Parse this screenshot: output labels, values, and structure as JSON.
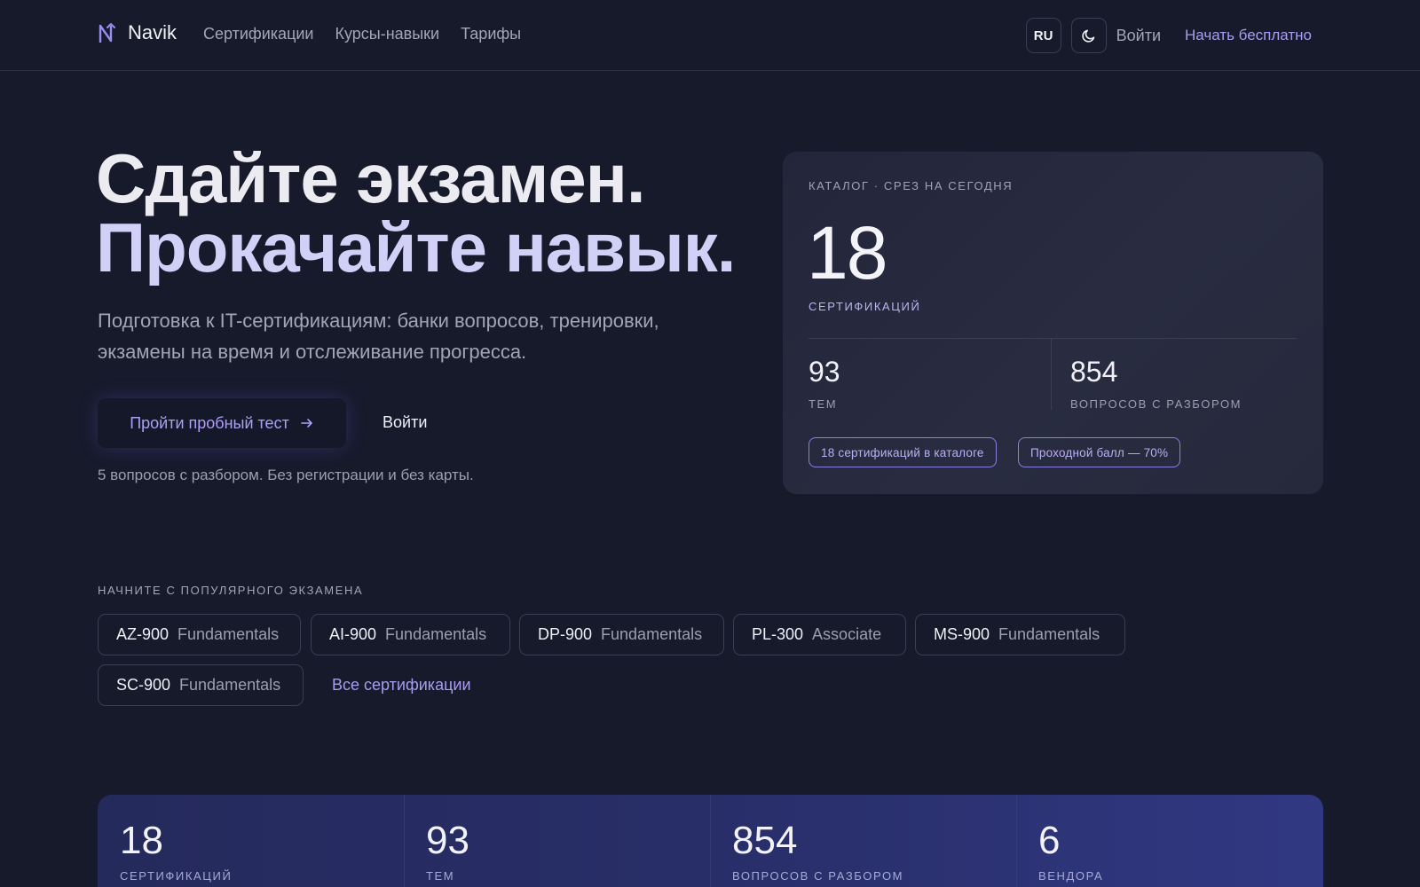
{
  "nav": {
    "logo_text": "Navik",
    "links": [
      "Сертификации",
      "Курсы-навыки",
      "Тарифы"
    ],
    "lang": "RU",
    "login": "Войти",
    "cta": "Начать бесплатно"
  },
  "hero": {
    "title_line1": "Сдайте экзамен.",
    "title_line2": "Прокачайте навык.",
    "subtitle": "Подготовка к IT-сертификациям: банки вопросов, тренировки, экзамены на время и отслеживание прогресса.",
    "primary_button": "Пройти пробный тест",
    "secondary_button": "Войти",
    "note": "5 вопросов с разбором. Без регистрации и без карты."
  },
  "catalog": {
    "eyebrow": "КАТАЛОГ · СРЕЗ НА СЕГОДНЯ",
    "certifications_value": "18",
    "certifications_label": "СЕРТИФИКАЦИЙ",
    "topics_value": "93",
    "topics_label": "ТЕМ",
    "questions_value": "854",
    "questions_label": "ВОПРОСОВ С РАЗБОРОМ",
    "badges": [
      "18 сертификаций в каталоге",
      "Проходной балл — 70%"
    ]
  },
  "popular": {
    "label": "НАЧНИТЕ С ПОПУЛЯРНОГО ЭКЗАМЕНА",
    "exams": [
      {
        "code": "AZ-900",
        "level": "Fundamentals"
      },
      {
        "code": "AI-900",
        "level": "Fundamentals"
      },
      {
        "code": "DP-900",
        "level": "Fundamentals"
      },
      {
        "code": "PL-300",
        "level": "Associate"
      },
      {
        "code": "MS-900",
        "level": "Fundamentals"
      },
      {
        "code": "SC-900",
        "level": "Fundamentals"
      }
    ],
    "all_link": "Все сертификации"
  },
  "stats": [
    {
      "value": "18",
      "label": "СЕРТИФИКАЦИЙ"
    },
    {
      "value": "93",
      "label": "ТЕМ"
    },
    {
      "value": "854",
      "label": "ВОПРОСОВ С РАЗБОРОМ"
    },
    {
      "value": "6",
      "label": "ВЕНДОРА"
    }
  ],
  "colors": {
    "background": "#161a2b",
    "accent": "#a99cf0",
    "heading_accent": "#d3d0f7",
    "band": "#282e68"
  },
  "icons": {
    "logo": "navik-logo-icon",
    "theme_toggle": "moon-icon",
    "button_arrow": "arrow-right-icon"
  }
}
